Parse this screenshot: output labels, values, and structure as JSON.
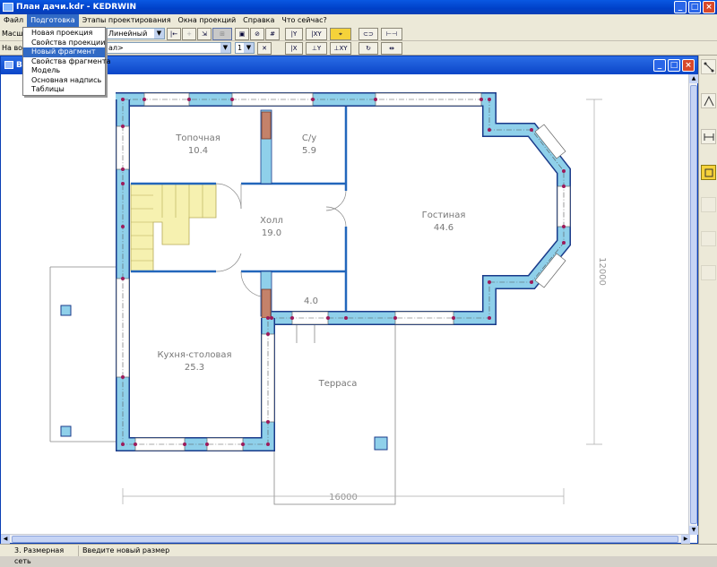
{
  "app": {
    "title": "План дачи.kdr - KEDRWIN",
    "window_buttons": [
      "_",
      "□",
      "×"
    ]
  },
  "menu": [
    {
      "label": "Файл",
      "active": false
    },
    {
      "label": "Подготовка",
      "active": true
    },
    {
      "label": "Этапы проектирования",
      "active": false
    },
    {
      "label": "Окна проекций",
      "active": false
    },
    {
      "label": "Справка",
      "active": false
    },
    {
      "label": "Что сейчас?",
      "active": false
    }
  ],
  "dropdown": {
    "items": [
      "Новая проекция",
      "Свойства проекции",
      "Новый фрагмент",
      "Свойства фрагмента",
      "Модель",
      "Основная надпись",
      "Таблицы"
    ],
    "highlighted_index": 2
  },
  "toolbar": {
    "scale_label": "Масшт",
    "line_type": "Линейный",
    "row2_label": "На во",
    "row2_combo_tail": "ал>",
    "num_combo": "1",
    "buttons": [
      "|Y",
      "|XY",
      "|X",
      "⊥Y",
      "⊥XY",
      "⊥X"
    ]
  },
  "child_window": {
    "title": "В",
    "buttons": [
      "_",
      "□",
      "×"
    ]
  },
  "plan": {
    "rooms": [
      {
        "name": "Топочная",
        "area": "10.4"
      },
      {
        "name": "С/у",
        "area": "5.9"
      },
      {
        "name": "Холл",
        "area": "19.0"
      },
      {
        "name": "Гостиная",
        "area": "44.6"
      },
      {
        "name": "",
        "area": "4.0"
      },
      {
        "name": "Кухня-столовая",
        "area": "25.3"
      },
      {
        "name": "Терраса",
        "area": ""
      }
    ],
    "dimensions": {
      "horizontal": "16000",
      "vertical": "12000"
    },
    "colors": {
      "wall": "#8fd0ea",
      "wall_outline": "#1a3a8a",
      "stairs": "#f6f1b0",
      "node": "#9c1a5a",
      "brick": "#c4826a",
      "interior_wall": "#2266bb"
    }
  },
  "status": {
    "pane1": "3. Размерная сеть",
    "pane2": "Введите новый размер"
  }
}
